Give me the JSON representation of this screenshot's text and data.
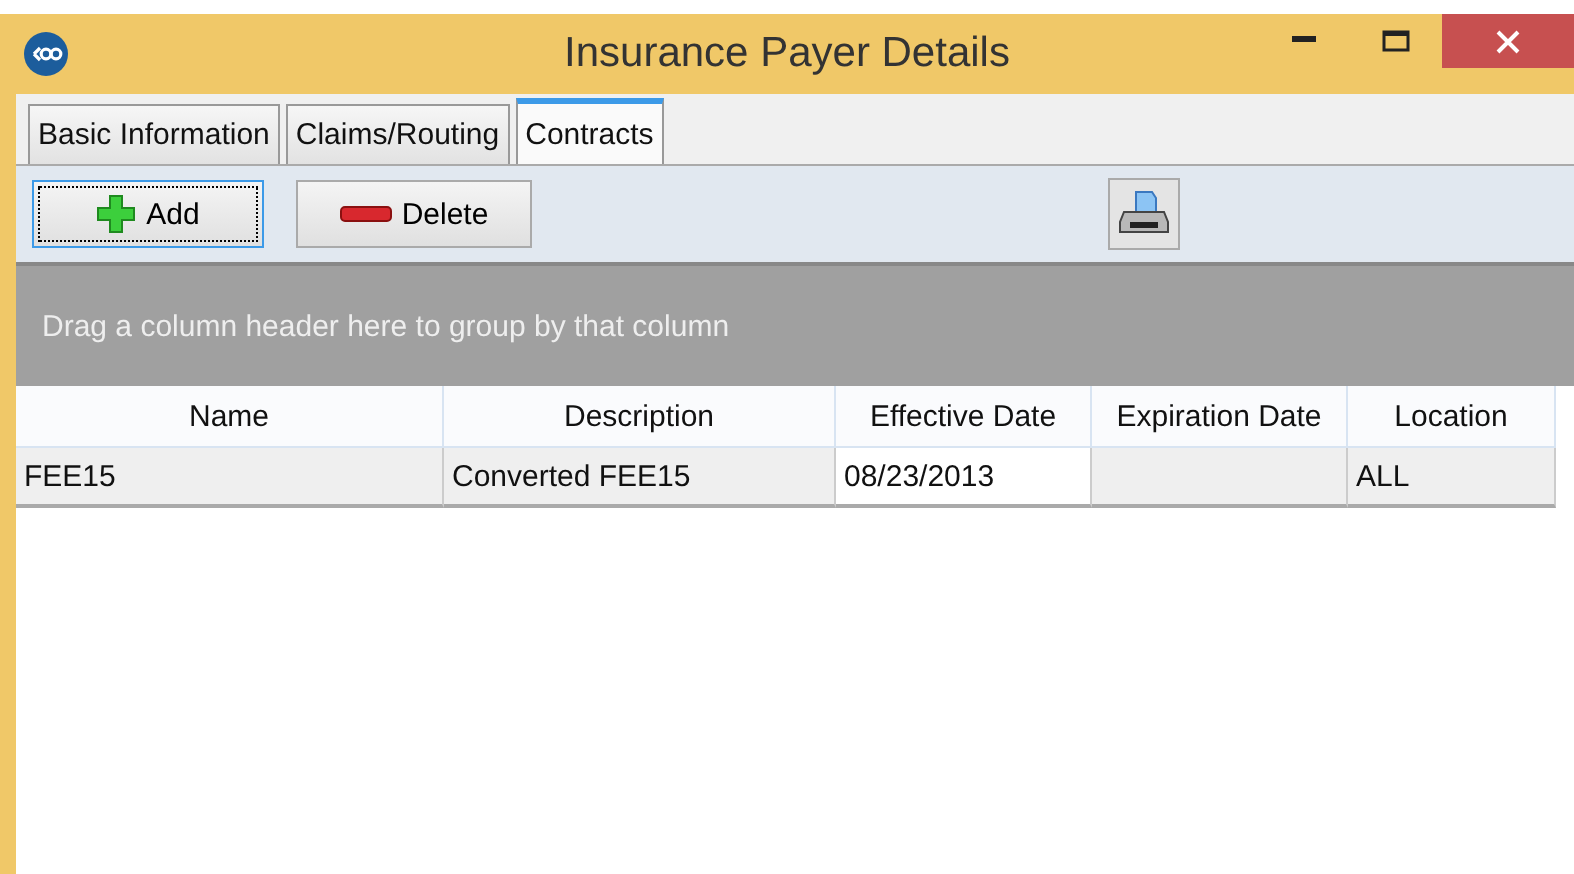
{
  "window": {
    "title": "Insurance Payer Details"
  },
  "tabs": [
    {
      "label": "Basic Information",
      "selected": false
    },
    {
      "label": "Claims/Routing",
      "selected": false
    },
    {
      "label": "Contracts",
      "selected": true
    }
  ],
  "toolbar": {
    "buttons": [
      {
        "kind": "add",
        "label": "Add",
        "focused": true
      },
      {
        "kind": "delete",
        "label": "Delete",
        "focused": false
      }
    ]
  },
  "group_panel": {
    "hint": "Drag a column header here to group by that column"
  },
  "table": {
    "columns": [
      "Name",
      "Description",
      "Effective Date",
      "Expiration Date",
      "Location"
    ],
    "rows": [
      {
        "cells": [
          {
            "text": "FEE15",
            "focused": false
          },
          {
            "text": "Converted FEE15",
            "focused": false
          },
          {
            "text": "08/23/2013",
            "focused": true
          },
          {
            "text": "",
            "focused": false
          },
          {
            "text": "ALL",
            "focused": false
          }
        ]
      }
    ]
  }
}
